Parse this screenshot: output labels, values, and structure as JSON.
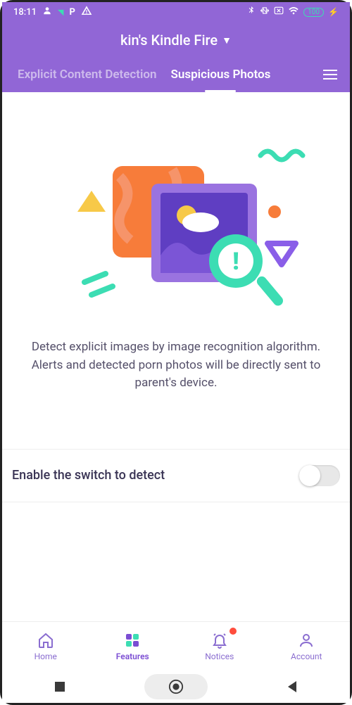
{
  "status_bar": {
    "time": "18:11",
    "battery": "100"
  },
  "header": {
    "device_title": "kin's Kindle Fire",
    "tabs": [
      {
        "label": "Explicit Content Detection"
      },
      {
        "label": "Suspicious Photos"
      }
    ]
  },
  "description": "Detect explicit images by image recognition algorithm. Alerts and detected porn photos will be directly sent to parent's device.",
  "setting": {
    "label": "Enable the switch to detect",
    "enabled": false
  },
  "bottom_nav": {
    "items": [
      {
        "label": "Home"
      },
      {
        "label": "Features"
      },
      {
        "label": "Notices"
      },
      {
        "label": "Account"
      }
    ]
  },
  "colors": {
    "primary": "#9166d6",
    "accent": "#3cddb3",
    "orange": "#f77c3a"
  }
}
